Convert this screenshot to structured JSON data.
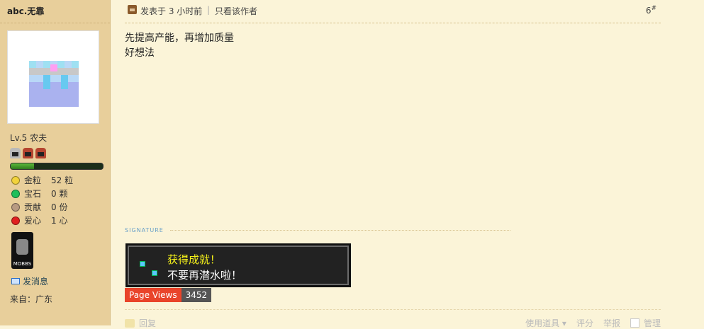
{
  "user": {
    "name": "abc.无靠",
    "level": "Lv.5 农夫",
    "stats": [
      {
        "label": "金粒",
        "value": "52 粒",
        "icon": "gold-nugget-icon",
        "color": "#f2d33c"
      },
      {
        "label": "宝石",
        "value": "0 颗",
        "icon": "gem-icon",
        "color": "#1fbf5a"
      },
      {
        "label": "贡献",
        "value": "0 份",
        "icon": "contribution-icon",
        "color": "#b79a82"
      },
      {
        "label": "爱心",
        "value": "1 心",
        "icon": "heart-apple-icon",
        "color": "#e02020"
      }
    ],
    "medal": "MOBBS",
    "send_message": "发消息",
    "origin": "来自：广东"
  },
  "post": {
    "posted_time": "发表于 3 小时前",
    "only_author": "只看该作者",
    "floor": "6",
    "floor_mark": "#",
    "lines": [
      "先提高产能，再增加质量",
      "好想法"
    ]
  },
  "signature": {
    "label": "SIGNATURE",
    "achievement_title": "获得成就！",
    "achievement_text": "不要再潜水啦！",
    "page_views_label": "Page Views",
    "page_views_count": "3452"
  },
  "footer": {
    "reply": "回复",
    "use_item": "使用道具",
    "rate": "评分",
    "report": "举报",
    "manage": "管理"
  },
  "colors": {
    "sidebar_bg": "#e8cf9b",
    "page_bg": "#fbf4d8",
    "achievement_title": "#f4f01a",
    "page_views_label_bg": "#e9442a"
  }
}
